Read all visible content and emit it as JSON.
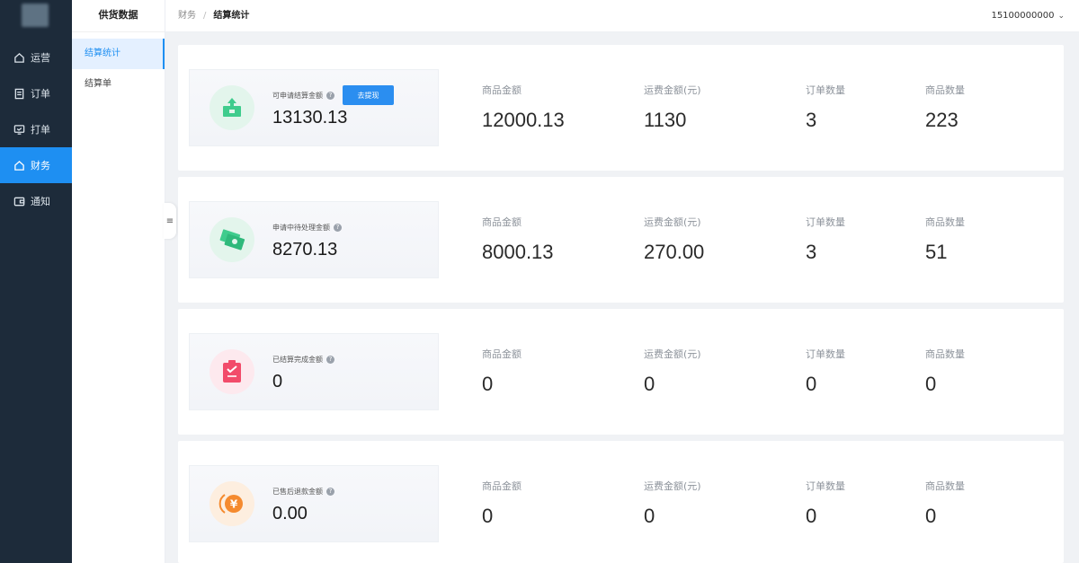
{
  "nav": {
    "items": [
      {
        "label": "运营",
        "icon": "home-icon"
      },
      {
        "label": "订单",
        "icon": "document-icon"
      },
      {
        "label": "打单",
        "icon": "printer-icon"
      },
      {
        "label": "财务",
        "icon": "home-icon",
        "active": true
      },
      {
        "label": "通知",
        "icon": "wallet-icon"
      }
    ]
  },
  "subnav": {
    "title": "供货数据",
    "items": [
      {
        "label": "结算统计",
        "active": true
      },
      {
        "label": "结算单"
      }
    ]
  },
  "header": {
    "breadcrumb": [
      "财务",
      "结算统计"
    ],
    "separator": "/",
    "user": "15100000000"
  },
  "colors": {
    "accent": "#1e8ff2",
    "nav_bg": "#1d2b3a",
    "green_icon": "#3fcc8d",
    "red_icon": "#f24b6a",
    "orange_icon": "#f58a2e"
  },
  "cards": [
    {
      "summary_label": "可申请结算金额",
      "amount": "13130.13",
      "button": "去提现",
      "icon": "upload-box-icon",
      "stats": [
        {
          "label": "商品金额",
          "value": "12000.13"
        },
        {
          "label": "运费金额(元)",
          "value": "1130"
        },
        {
          "label": "订单数量",
          "value": "3"
        },
        {
          "label": "商品数量",
          "value": "223"
        }
      ]
    },
    {
      "summary_label": "申请中待处理金额",
      "amount": "8270.13",
      "icon": "money-bill-icon",
      "stats": [
        {
          "label": "商品金额",
          "value": "8000.13"
        },
        {
          "label": "运费金额(元)",
          "value": "270.00"
        },
        {
          "label": "订单数量",
          "value": "3"
        },
        {
          "label": "商品数量",
          "value": "51"
        }
      ]
    },
    {
      "summary_label": "已结算完成金额",
      "amount": "0",
      "icon": "clipboard-check-icon",
      "stats": [
        {
          "label": "商品金额",
          "value": "0"
        },
        {
          "label": "运费金额(元)",
          "value": "0"
        },
        {
          "label": "订单数量",
          "value": "0"
        },
        {
          "label": "商品数量",
          "value": "0"
        }
      ]
    },
    {
      "summary_label": "已售后退款金额",
      "amount": "0.00",
      "icon": "yen-coin-icon",
      "stats": [
        {
          "label": "商品金额",
          "value": "0"
        },
        {
          "label": "运费金额(元)",
          "value": "0"
        },
        {
          "label": "订单数量",
          "value": "0"
        },
        {
          "label": "商品数量",
          "value": "0"
        }
      ]
    }
  ]
}
